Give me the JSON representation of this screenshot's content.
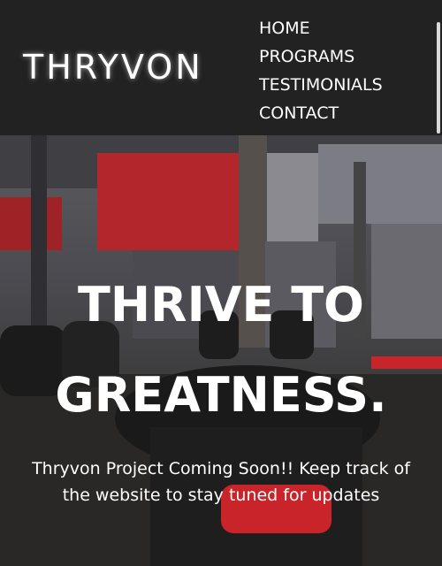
{
  "header": {
    "logo": "THRYVON",
    "nav": [
      "HOME",
      "PROGRAMS",
      "TESTIMONIALS",
      "CONTACT"
    ]
  },
  "hero": {
    "line1": "THRIVE TO",
    "line2": "GREATNESS.",
    "subtitle": "Thryvon Project Coming Soon!! Keep track of the website to stay tuned for updates"
  },
  "colors": {
    "header_bg": "#222222",
    "text": "#ffffff",
    "accent_red": "#c8242a"
  }
}
